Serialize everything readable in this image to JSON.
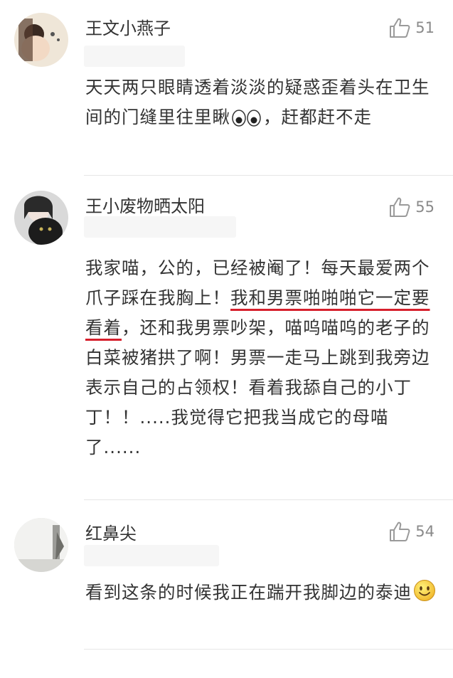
{
  "comments": [
    {
      "username": "王文小燕子",
      "likes": "51",
      "text": "天天两只眼睛透着淡淡的疑惑歪着头在卫生间的门缝里往里瞅",
      "text_after_emoji": "，赶都赶不走",
      "emoji": "eyes-emoji"
    },
    {
      "username": "王小废物晒太阳",
      "likes": "55",
      "text_before": "我家喵，公的，已经被阉了！每天最爱两个爪子踩在我胸上！",
      "text_highlight": "我和男票啪啪啪它一定要看着",
      "text_after": "，还和我男票吵架，喵呜喵呜的老子的白菜被猪拱了啊！男票一走马上跳到我旁边表示自己的占领权！看着我舔自己的小丁丁！！.....我觉得它把我当成它的母喵了......",
      "highlight_color": "#d61f2c"
    },
    {
      "username": "红鼻尖",
      "likes": "54",
      "text": "看到这条的时候我正在踹开我脚边的泰迪",
      "emoji": "smile-emoji"
    }
  ]
}
